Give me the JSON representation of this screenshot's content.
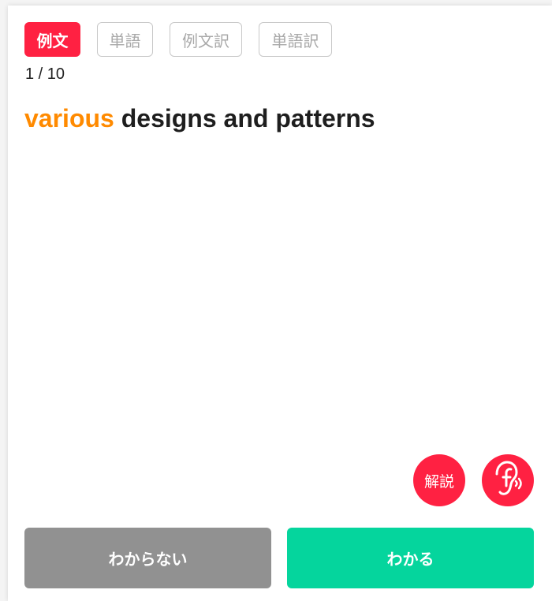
{
  "tabs": [
    {
      "label": "例文",
      "active": true
    },
    {
      "label": "単語",
      "active": false
    },
    {
      "label": "例文訳",
      "active": false
    },
    {
      "label": "単語訳",
      "active": false
    }
  ],
  "progress": "1 / 10",
  "sentence": {
    "highlight": "various",
    "rest": " designs and patterns"
  },
  "buttons": {
    "explain_label": "解説",
    "audio_icon": "ear-sound-icon",
    "unknown_label": "わからない",
    "known_label": "わかる"
  },
  "colors": {
    "accent_red": "#ff2142",
    "highlight_orange": "#ff8a00",
    "known_green": "#05d59d",
    "unknown_gray": "#919191"
  }
}
